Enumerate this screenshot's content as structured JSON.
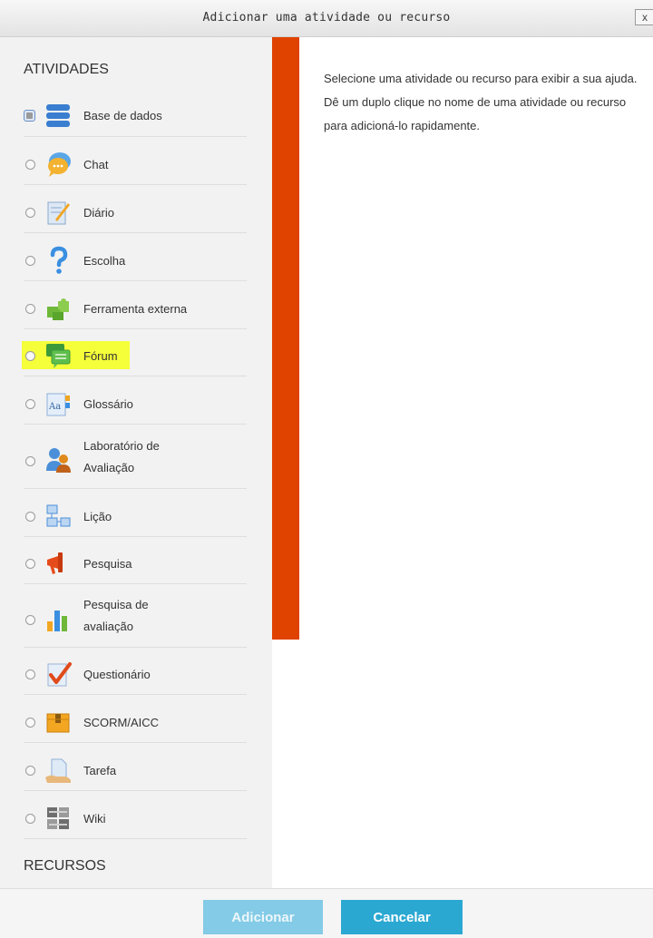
{
  "dialog": {
    "title": "Adicionar uma atividade ou recurso",
    "close_label": "x",
    "help_text": "Selecione uma atividade ou recurso para exibir a sua ajuda. Dê um duplo clique no nome de uma atividade ou recurso para adicioná-lo rapidamente."
  },
  "sections": {
    "activities_label": "ATIVIDADES",
    "resources_label": "RECURSOS"
  },
  "activities": [
    {
      "label": "Base de dados",
      "icon": "database-icon"
    },
    {
      "label": "Chat",
      "icon": "chat-icon"
    },
    {
      "label": "Diário",
      "icon": "journal-icon"
    },
    {
      "label": "Escolha",
      "icon": "question-icon"
    },
    {
      "label": "Ferramenta externa",
      "icon": "puzzle-icon"
    },
    {
      "label": "Fórum",
      "icon": "forum-icon"
    },
    {
      "label": "Glossário",
      "icon": "glossary-icon"
    },
    {
      "label": "Laboratório de Avaliação",
      "line1": "Laboratório de",
      "line2": "Avaliação",
      "icon": "workshop-icon"
    },
    {
      "label": "Lição",
      "icon": "lesson-icon"
    },
    {
      "label": "Pesquisa",
      "icon": "megaphone-icon"
    },
    {
      "label": "Pesquisa de avaliação",
      "line1": "Pesquisa de",
      "line2": "avaliação",
      "icon": "bar-chart-icon"
    },
    {
      "label": "Questionário",
      "icon": "checkmark-icon"
    },
    {
      "label": "SCORM/AICC",
      "icon": "package-icon"
    },
    {
      "label": "Tarefa",
      "icon": "assignment-icon"
    },
    {
      "label": "Wiki",
      "icon": "wiki-icon"
    }
  ],
  "colors": {
    "accent": "#e04200",
    "highlight": "#f5ff3a",
    "primary_button": "#2ba8d2",
    "disabled_button": "#83cbe6"
  },
  "footer": {
    "add_label": "Adicionar",
    "cancel_label": "Cancelar"
  }
}
